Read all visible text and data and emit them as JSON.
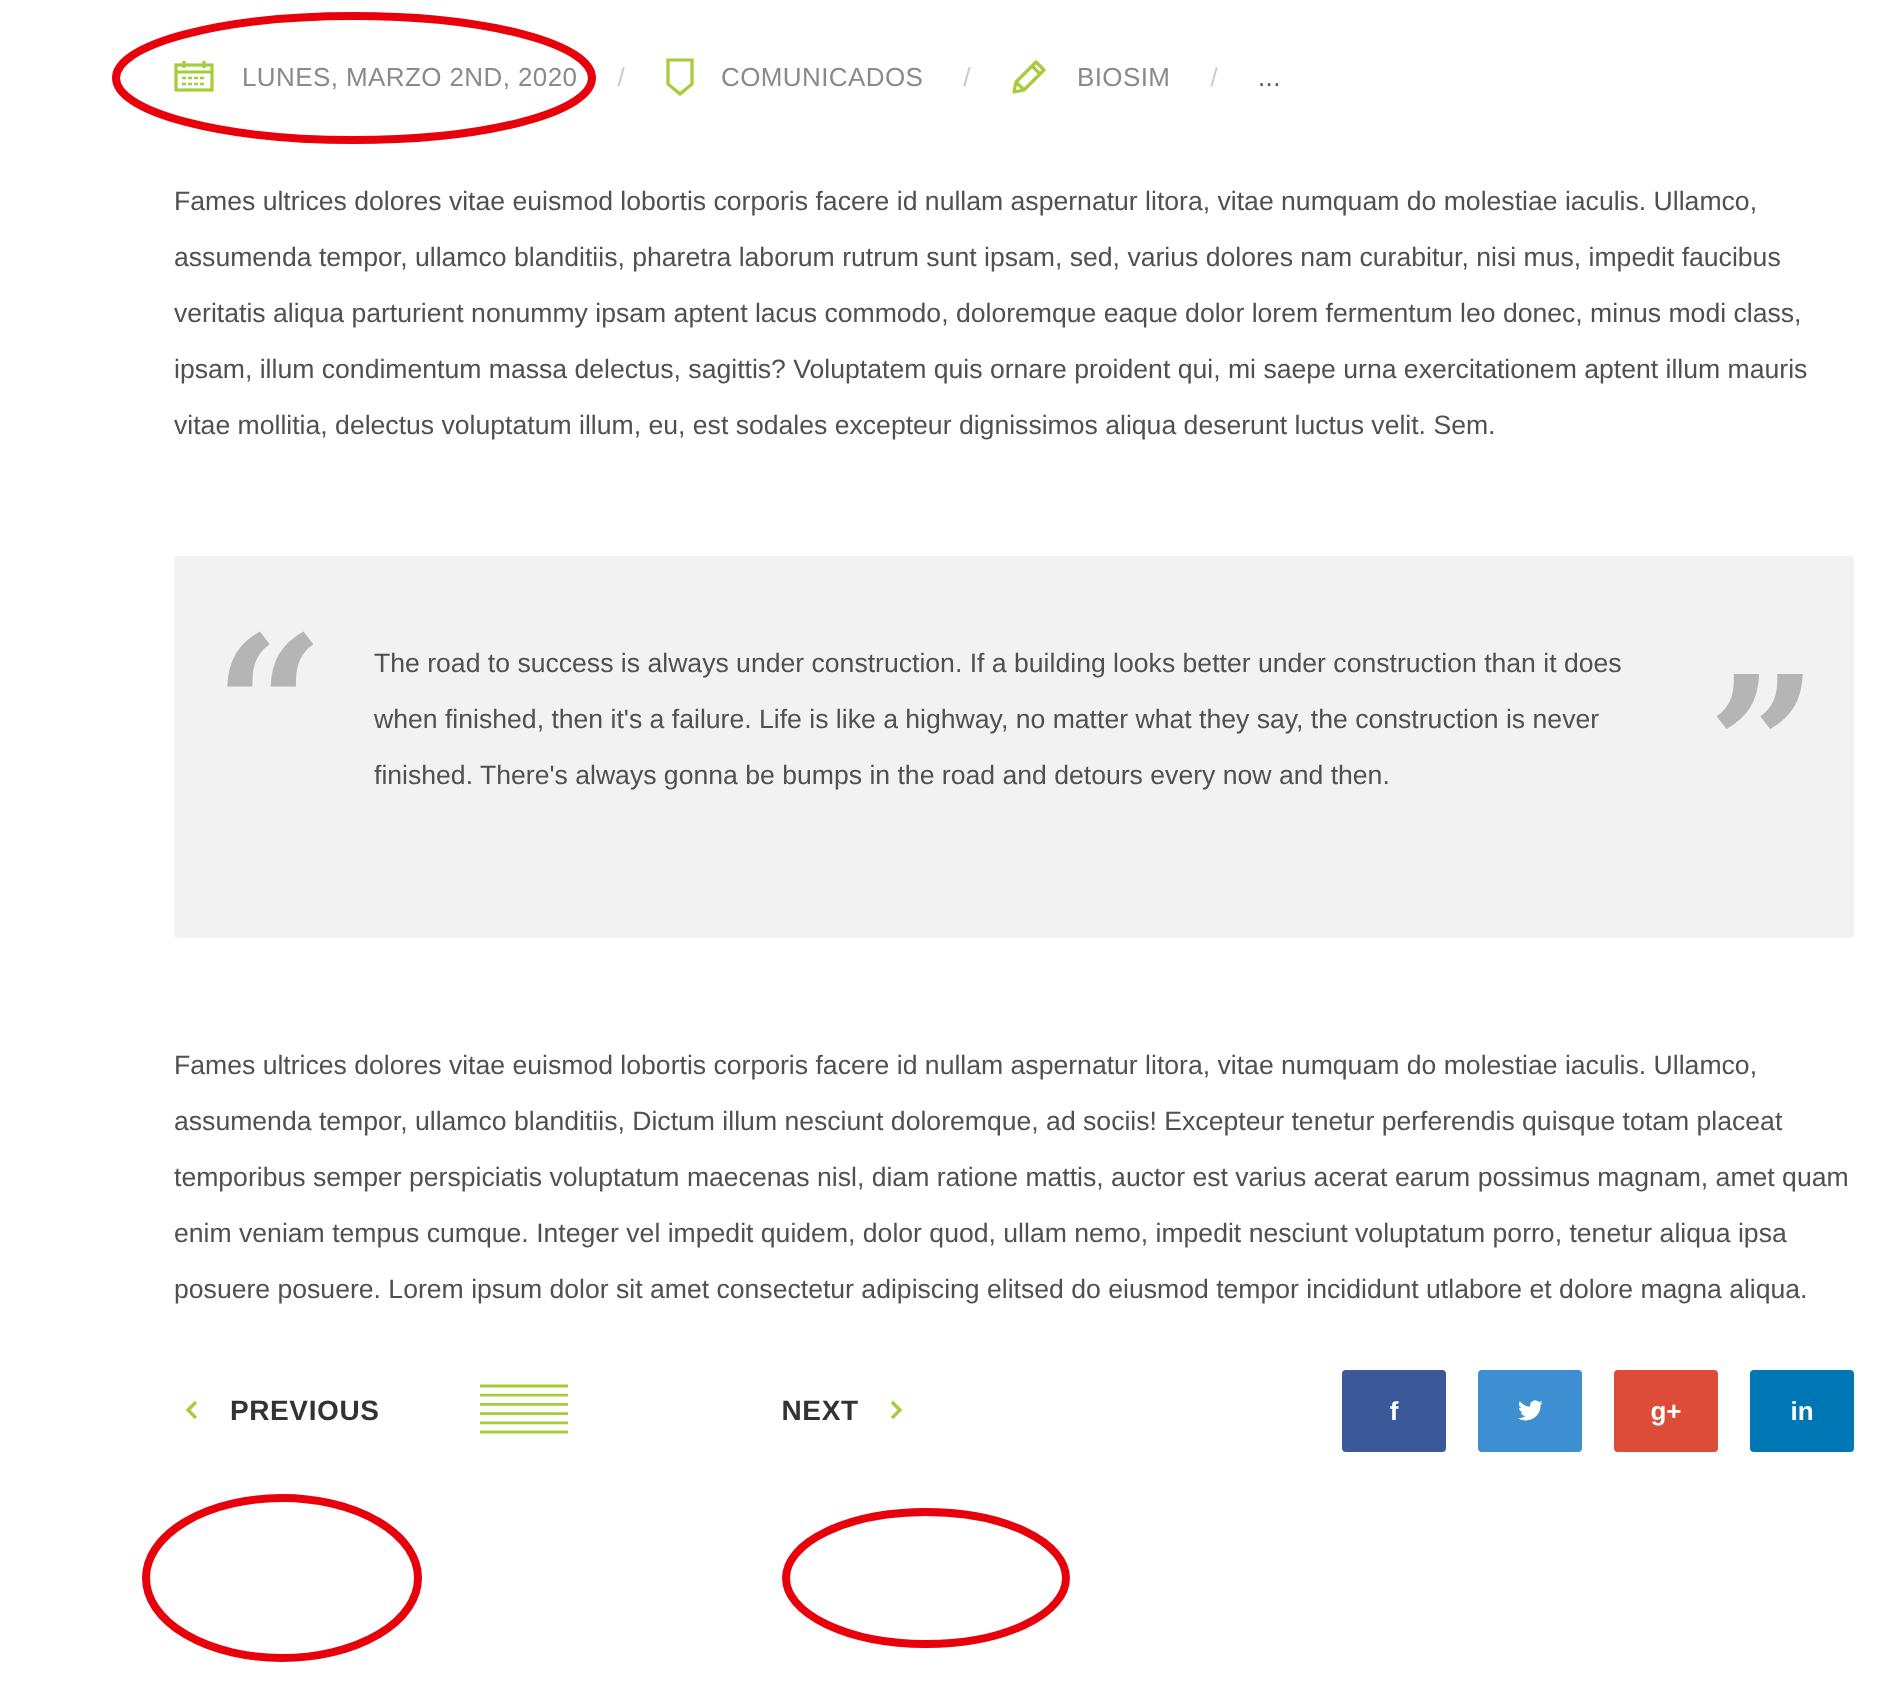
{
  "meta": [
    {
      "kind": "date",
      "text": "LUNES, MARZO 2ND, 2020"
    },
    {
      "kind": "separator",
      "text": "/"
    },
    {
      "kind": "category",
      "text": "COMUNICADOS"
    },
    {
      "kind": "separator",
      "text": "/"
    },
    {
      "kind": "author",
      "text": "BIOSIM"
    },
    {
      "kind": "separator",
      "text": "/"
    },
    {
      "kind": "more",
      "text": "..."
    }
  ],
  "paragraphs_top": [
    "Fames ultrices dolores vitae euismod lobortis corporis facere id nullam aspernatur litora, vitae numquam do molestiae iaculis. Ullamco, assumenda tempor, ullamco blanditiis, pharetra laborum rutrum sunt ipsam, sed, varius dolores nam curabitur, nisi mus, impedit faucibus veritatis aliqua parturient nonummy ipsam aptent lacus commodo, doloremque eaque dolor lorem fermentum leo donec, minus modi class, ipsam, illum condimentum massa delectus, sagittis? Voluptatem quis ornare proident qui, mi saepe urna exercitationem aptent illum mauris vitae mollitia, delectus voluptatum illum, eu, est sodales excepteur dignissimos aliqua deserunt luctus velit. Sem."
  ],
  "quote": {
    "open_mark": "“",
    "text": "The road to success is always under construction. If a building looks better under construction than it does when finished, then it's a failure. Life is like a highway, no matter what they say, the construction is never finished. There's always gonna be bumps in the road and detours every now and then.",
    "close_mark": "”"
  },
  "paragraphs_bottom": [
    "Fames ultrices dolores vitae euismod lobortis corporis facere id nullam aspernatur litora, vitae numquam do molestiae iaculis. Ullamco, assumenda tempor, ullamco blanditiis, Dictum illum nesciunt doloremque, ad sociis! Excepteur tenetur perferendis quisque totam placeat temporibus semper perspiciatis voluptatum maecenas nisl, diam ratione mattis, auctor est varius acerat earum possimus magnam, amet quam enim veniam tempus cumque. Integer vel impedit quidem, dolor quod, ullam nemo, impedit nesciunt voluptatum porro, tenetur aliqua ipsa posuere posuere. Lorem ipsum dolor sit amet consectetur adipiscing elitsed do eiusmod tempor incididunt utlabore et dolore magna aliqua."
  ],
  "nav": {
    "previous": "PREVIOUS",
    "next": "NEXT"
  },
  "social": [
    {
      "kind": "facebook",
      "label": "f",
      "color": "#3b5998"
    },
    {
      "kind": "twitter",
      "color": "#3d8fd1"
    },
    {
      "kind": "googleplus",
      "label": "g+",
      "color": "#dd4b39"
    },
    {
      "kind": "linkedin",
      "label": "in",
      "color": "#0077b5"
    }
  ]
}
